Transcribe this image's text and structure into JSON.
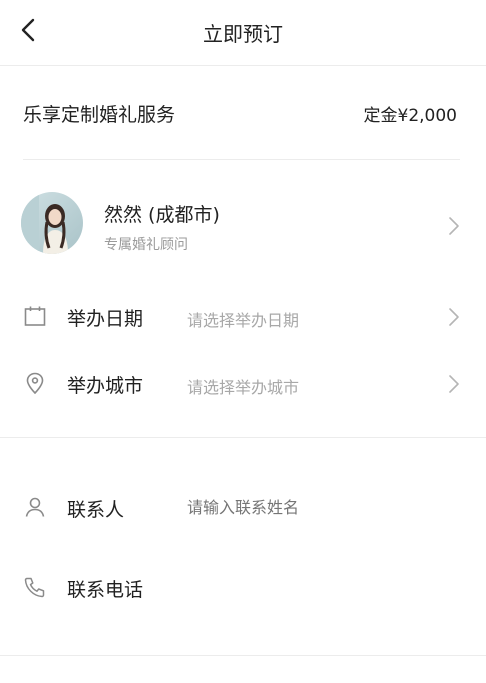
{
  "header": {
    "title": "立即预订"
  },
  "service": {
    "name": "乐享定制婚礼服务",
    "deposit": "定金¥2,000"
  },
  "consultant": {
    "name": "然然 (成都市)",
    "role": "专属婚礼顾问"
  },
  "form": {
    "date": {
      "label": "举办日期",
      "placeholder": "请选择举办日期",
      "icon": "calendar-icon"
    },
    "city": {
      "label": "举办城市",
      "placeholder": "请选择举办城市",
      "icon": "location-pin-icon"
    },
    "contact": {
      "label": "联系人",
      "placeholder": "请输入联系姓名",
      "icon": "person-icon"
    },
    "phone": {
      "label": "联系电话",
      "placeholder": "",
      "icon": "phone-icon"
    }
  },
  "colors": {
    "text": "#222222",
    "placeholder": "#a8a8a8",
    "divider": "#ececec",
    "icon": "#8a8a8a"
  }
}
